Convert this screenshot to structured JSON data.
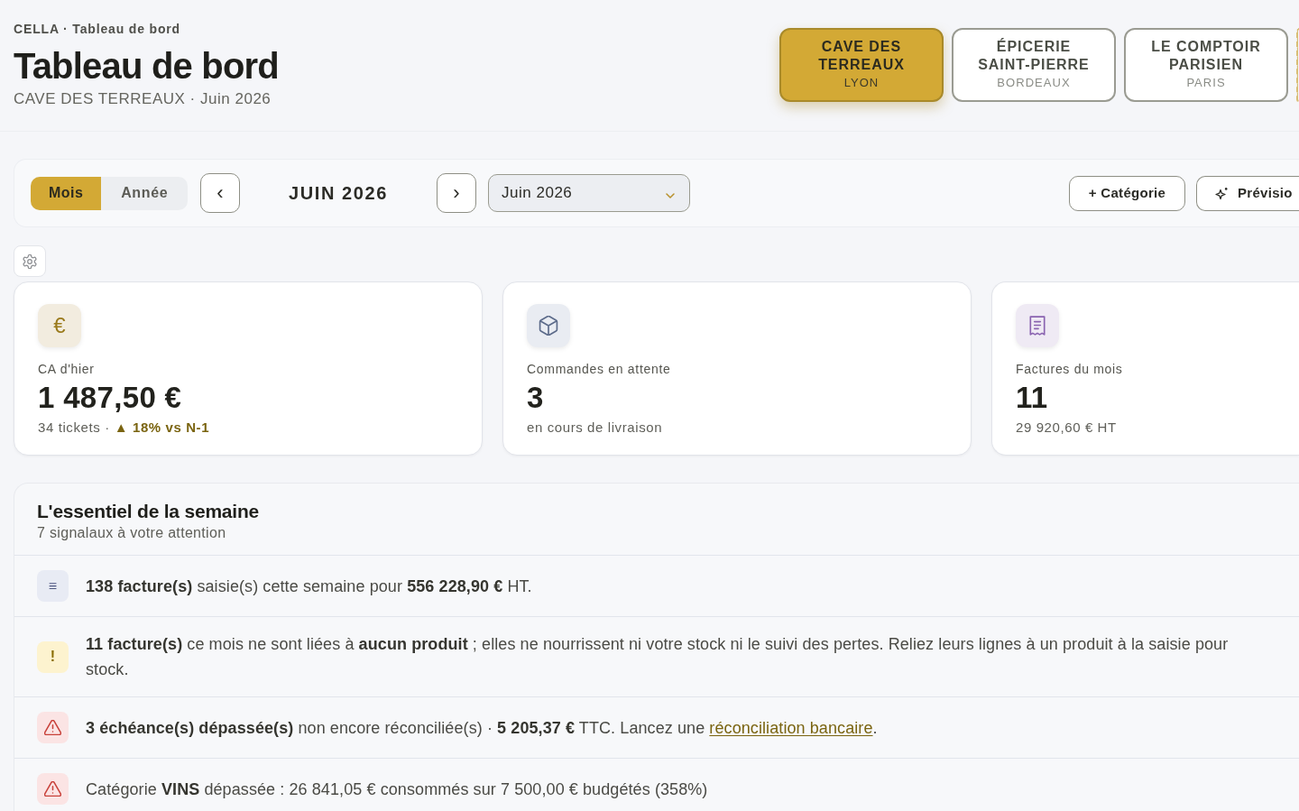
{
  "breadcrumb": "CELLA · Tableau de bord",
  "title": "Tableau de bord",
  "subtitle": "CAVE DES TERREAUX · Juin 2026",
  "stores": [
    {
      "name": "CAVE DES TERREAUX",
      "city": "LYON",
      "selected": true
    },
    {
      "name": "ÉPICERIE SAINT-PIERRE",
      "city": "BORDEAUX",
      "selected": false
    },
    {
      "name": "LE COMPTOIR PARISIEN",
      "city": "PARIS",
      "selected": false
    }
  ],
  "period_toggle": [
    {
      "label": "Mois",
      "selected": true
    },
    {
      "label": "Année",
      "selected": false
    }
  ],
  "period": {
    "prev": "‹",
    "label": "JUIN 2026",
    "next": "›"
  },
  "period_select": {
    "value": "Juin 2026"
  },
  "actions": [
    {
      "kind": "add",
      "label": "+ Catégorie"
    },
    {
      "kind": "forecast",
      "label": "Prévisio"
    }
  ],
  "kpis": [
    {
      "kind": "revenue",
      "icon": "€",
      "label": "CA d'hier",
      "value": "1 487,50 €",
      "detail": "34 tickets ·",
      "trend": "▲ 18% vs N-1"
    },
    {
      "kind": "orders",
      "label": "Commandes en attente",
      "value": "3",
      "detail": "en cours de livraison"
    },
    {
      "kind": "invoices",
      "label": "Factures du mois",
      "value": "11",
      "detail": "29 920,60 € HT"
    }
  ],
  "signals": {
    "title": "L'essentiel de la semaine",
    "subtitle": "7 signalaux à votre attention",
    "items": [
      {
        "kind": "info",
        "icon": "≡",
        "text": "**138 facture(s)** saisie(s) cette semaine pour **556 228,90 €** HT."
      },
      {
        "kind": "warning",
        "icon": "!",
        "text": "**11 facture(s)** ce mois ne sont liées à **aucun produit** ; elles ne nourrissent ni votre stock ni le suivi des pertes. Reliez leurs lignes à un produit à la saisie pour stock."
      },
      {
        "kind": "danger",
        "text": "**3 échéance(s) dépassée(s)** non encore réconciliée(s) · **5 205,37 €** TTC. Lancez une ",
        "link": "réconciliation bancaire",
        "text_after": "."
      },
      {
        "kind": "danger",
        "text": "Catégorie **VINS** dépassée : 26 841,05 € consommés sur 7 500,00 € budgétés (358%)"
      }
    ]
  }
}
